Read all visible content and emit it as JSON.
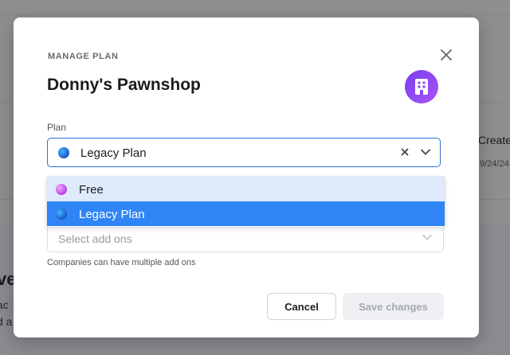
{
  "background": {
    "column_header": "Create",
    "date_fragment": "9/24/24",
    "heading_fragment": "ve",
    "text_fragment_1": "ac",
    "text_fragment_2": "d a"
  },
  "modal": {
    "eyebrow": "MANAGE PLAN",
    "company_name": "Donny's Pawnshop",
    "avatar_icon": "building-icon",
    "plan_field": {
      "label": "Plan",
      "value": "Legacy Plan"
    },
    "plan_options": [
      {
        "label": "Free",
        "state": "hover"
      },
      {
        "label": "Legacy Plan",
        "state": "selected"
      }
    ],
    "addons_field": {
      "placeholder": "Select add ons",
      "helper": "Companies can have multiple add ons"
    },
    "buttons": {
      "cancel": "Cancel",
      "save": "Save changes"
    }
  },
  "colors": {
    "accent": "#2f6fd9",
    "selected_option": "#2f85f6",
    "hover_option": "#deeafb",
    "avatar": "#8b45f3"
  }
}
